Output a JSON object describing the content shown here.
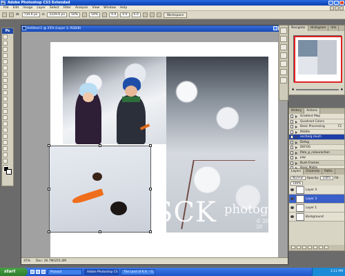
{
  "app": {
    "title": "Adobe Photoshop CS3 Extended"
  },
  "menu": [
    "File",
    "Edit",
    "Image",
    "Layer",
    "Select",
    "Filter",
    "Analysis",
    "View",
    "Window",
    "Help"
  ],
  "options": {
    "w_label": "W:",
    "w_value": "734.6 px",
    "h_label": "H:",
    "h_value": "2229.6 px",
    "w_pct": "50%",
    "h_pct": "50%",
    "angle": "0.0",
    "h_skew": "0.0",
    "v_skew": "0.0",
    "workspace": "Workspace"
  },
  "document": {
    "title": "Untitled-1 @ 25% (Layer 3, RGB/8)",
    "zoom": "25%",
    "doc_info": "Doc: 26.7M/255.4M"
  },
  "watermark": {
    "big": "SCK",
    "sub": "photogr",
    "copy": "© 2007 20"
  },
  "navigator": {
    "tabs": [
      "Navigator",
      "Histogram",
      "Info"
    ]
  },
  "actions": {
    "tabs": [
      "History",
      "Actions"
    ],
    "rows": [
      {
        "label": "Gradient Map",
        "key": ""
      },
      {
        "label": "Quadrant Colors",
        "key": ""
      },
      {
        "label": "Basic Processing",
        "key": "F2"
      },
      {
        "label": "Middle",
        "key": ""
      },
      {
        "label": "anchorg much",
        "key": "",
        "selected": true
      },
      {
        "label": "Defog",
        "key": "",
        "folder": true
      },
      {
        "label": "DEFOG",
        "key": ""
      },
      {
        "label": "Pete_p_colouraction",
        "key": "",
        "folder": true
      },
      {
        "label": "pop",
        "key": ""
      },
      {
        "label": "Bush Frames",
        "key": "",
        "folder": true
      },
      {
        "label": "Basic Matte",
        "key": ""
      },
      {
        "label": "Rosewood Landscape",
        "key": ""
      }
    ]
  },
  "layers": {
    "tabs": [
      "Layers",
      "Channels",
      "Paths"
    ],
    "blend_mode": "Normal",
    "opacity_label": "Opacity:",
    "opacity": "100%",
    "fill_label": "Fill:",
    "fill": "100%",
    "rows": [
      {
        "name": "Layer 4",
        "selected": false
      },
      {
        "name": "Layer 3",
        "selected": true
      },
      {
        "name": "Layer 1",
        "selected": false
      },
      {
        "name": "Background",
        "selected": false,
        "background": true
      }
    ]
  },
  "taskbar": {
    "start": "start",
    "tasks": [
      "Picasa3",
      "Adobe Photoshop CS3...",
      "The Land of K.A. - G..."
    ],
    "time": "1:11 PM"
  },
  "colors": {
    "titlebar": "#0b3fb0",
    "selection": "#1f3fa8",
    "nose": "#ef6e1c",
    "nav_box": "#e02020"
  }
}
